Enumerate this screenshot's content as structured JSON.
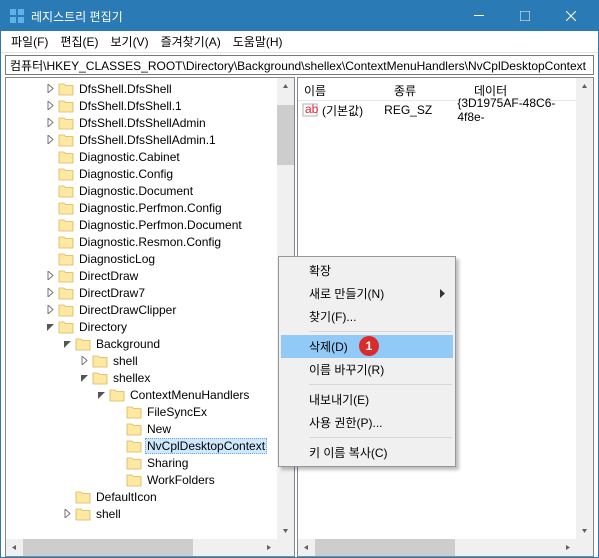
{
  "window": {
    "title": "레지스트리 편집기"
  },
  "menu": {
    "file": "파일(F)",
    "edit": "편집(E)",
    "view": "보기(V)",
    "favorites": "즐겨찾기(A)",
    "help": "도움말(H)"
  },
  "address": "컴퓨터\\HKEY_CLASSES_ROOT\\Directory\\Background\\shellex\\ContextMenuHandlers\\NvCplDesktopContext",
  "tree": [
    {
      "indent": 2,
      "exp": "r",
      "label": "DfsShell.DfsShell"
    },
    {
      "indent": 2,
      "exp": "r",
      "label": "DfsShell.DfsShell.1"
    },
    {
      "indent": 2,
      "exp": "r",
      "label": "DfsShell.DfsShellAdmin"
    },
    {
      "indent": 2,
      "exp": "r",
      "label": "DfsShell.DfsShellAdmin.1"
    },
    {
      "indent": 2,
      "exp": "",
      "label": "Diagnostic.Cabinet"
    },
    {
      "indent": 2,
      "exp": "",
      "label": "Diagnostic.Config"
    },
    {
      "indent": 2,
      "exp": "",
      "label": "Diagnostic.Document"
    },
    {
      "indent": 2,
      "exp": "",
      "label": "Diagnostic.Perfmon.Config"
    },
    {
      "indent": 2,
      "exp": "",
      "label": "Diagnostic.Perfmon.Document"
    },
    {
      "indent": 2,
      "exp": "",
      "label": "Diagnostic.Resmon.Config"
    },
    {
      "indent": 2,
      "exp": "",
      "label": "DiagnosticLog"
    },
    {
      "indent": 2,
      "exp": "r",
      "label": "DirectDraw"
    },
    {
      "indent": 2,
      "exp": "r",
      "label": "DirectDraw7"
    },
    {
      "indent": 2,
      "exp": "r",
      "label": "DirectDrawClipper"
    },
    {
      "indent": 2,
      "exp": "d",
      "label": "Directory"
    },
    {
      "indent": 3,
      "exp": "d",
      "label": "Background"
    },
    {
      "indent": 4,
      "exp": "r",
      "label": "shell"
    },
    {
      "indent": 4,
      "exp": "d",
      "label": "shellex"
    },
    {
      "indent": 5,
      "exp": "d",
      "label": "ContextMenuHandlers"
    },
    {
      "indent": 6,
      "exp": "",
      "label": "FileSyncEx"
    },
    {
      "indent": 6,
      "exp": "",
      "label": "New"
    },
    {
      "indent": 6,
      "exp": "",
      "label": "NvCplDesktopContext",
      "sel": true
    },
    {
      "indent": 6,
      "exp": "",
      "label": "Sharing"
    },
    {
      "indent": 6,
      "exp": "",
      "label": "WorkFolders"
    },
    {
      "indent": 3,
      "exp": "",
      "label": "DefaultIcon"
    },
    {
      "indent": 3,
      "exp": "r",
      "label": "shell"
    }
  ],
  "list": {
    "cols": {
      "name": "이름",
      "type": "종류",
      "data": "데이터"
    },
    "col_widths": {
      "name": 90,
      "type": 80,
      "data": 200
    },
    "rows": [
      {
        "name": "(기본값)",
        "type": "REG_SZ",
        "data": "{3D1975AF-48C6-4f8e-"
      }
    ]
  },
  "ctx": {
    "expand": "확장",
    "new": "새로 만들기(N)",
    "find": "찾기(F)...",
    "delete": "삭제(D)",
    "rename": "이름 바꾸기(R)",
    "export": "내보내기(E)",
    "permissions": "사용 권한(P)...",
    "copykey": "키 이름 복사(C)"
  },
  "badge": "1"
}
